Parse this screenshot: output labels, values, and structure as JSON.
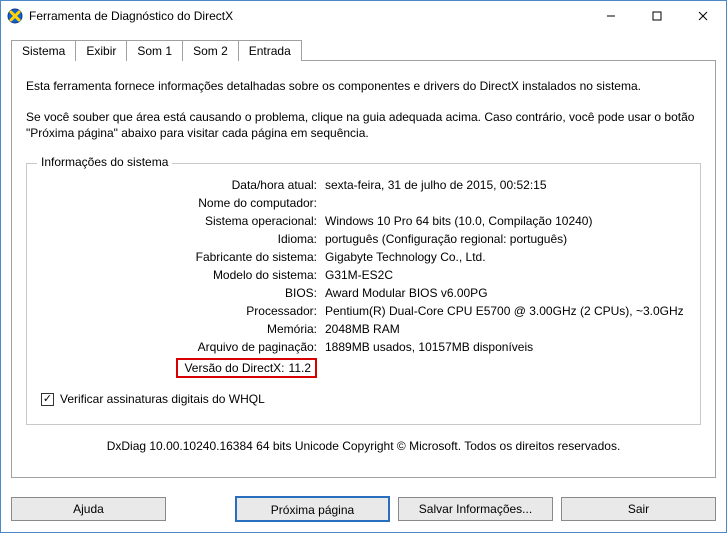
{
  "titlebar": {
    "title": "Ferramenta de Diagnóstico do DirectX"
  },
  "tabs": {
    "t0": "Sistema",
    "t1": "Exibir",
    "t2": "Som 1",
    "t3": "Som 2",
    "t4": "Entrada"
  },
  "intro": {
    "line1": "Esta ferramenta fornece informações detalhadas sobre os componentes e drivers do DirectX instalados no sistema.",
    "line2": "Se você souber que área está causando o problema, clique na guia adequada acima. Caso contrário, você pode usar o botão \"Próxima página\" abaixo para visitar cada página em sequência."
  },
  "sysinfo": {
    "legend": "Informações do sistema",
    "rows": {
      "datetime": {
        "label": "Data/hora atual:",
        "value": "sexta-feira, 31 de julho de 2015, 00:52:15"
      },
      "computer": {
        "label": "Nome do computador:",
        "value": " "
      },
      "os": {
        "label": "Sistema operacional:",
        "value": "Windows 10 Pro 64 bits (10.0, Compilação 10240)"
      },
      "lang": {
        "label": "Idioma:",
        "value": "português (Configuração regional: português)"
      },
      "mfr": {
        "label": "Fabricante do sistema:",
        "value": "Gigabyte Technology Co., Ltd."
      },
      "model": {
        "label": "Modelo do sistema:",
        "value": "G31M-ES2C"
      },
      "bios": {
        "label": "BIOS:",
        "value": "Award Modular BIOS v6.00PG"
      },
      "cpu": {
        "label": "Processador:",
        "value": "Pentium(R) Dual-Core  CPU      E5700  @ 3.00GHz (2 CPUs), ~3.0GHz"
      },
      "mem": {
        "label": "Memória:",
        "value": "2048MB RAM"
      },
      "page": {
        "label": "Arquivo de paginação:",
        "value": "1889MB usados, 10157MB disponíveis"
      },
      "dx": {
        "label": "Versão do DirectX:",
        "value": "11.2"
      }
    },
    "whql": {
      "checked": true,
      "label": "Verificar assinaturas digitais do WHQL"
    }
  },
  "footer": "DxDiag 10.00.10240.16384 64 bits Unicode  Copyright © Microsoft. Todos os direitos reservados.",
  "buttons": {
    "help": "Ajuda",
    "next": "Próxima página",
    "save": "Salvar Informações...",
    "exit": "Sair"
  }
}
